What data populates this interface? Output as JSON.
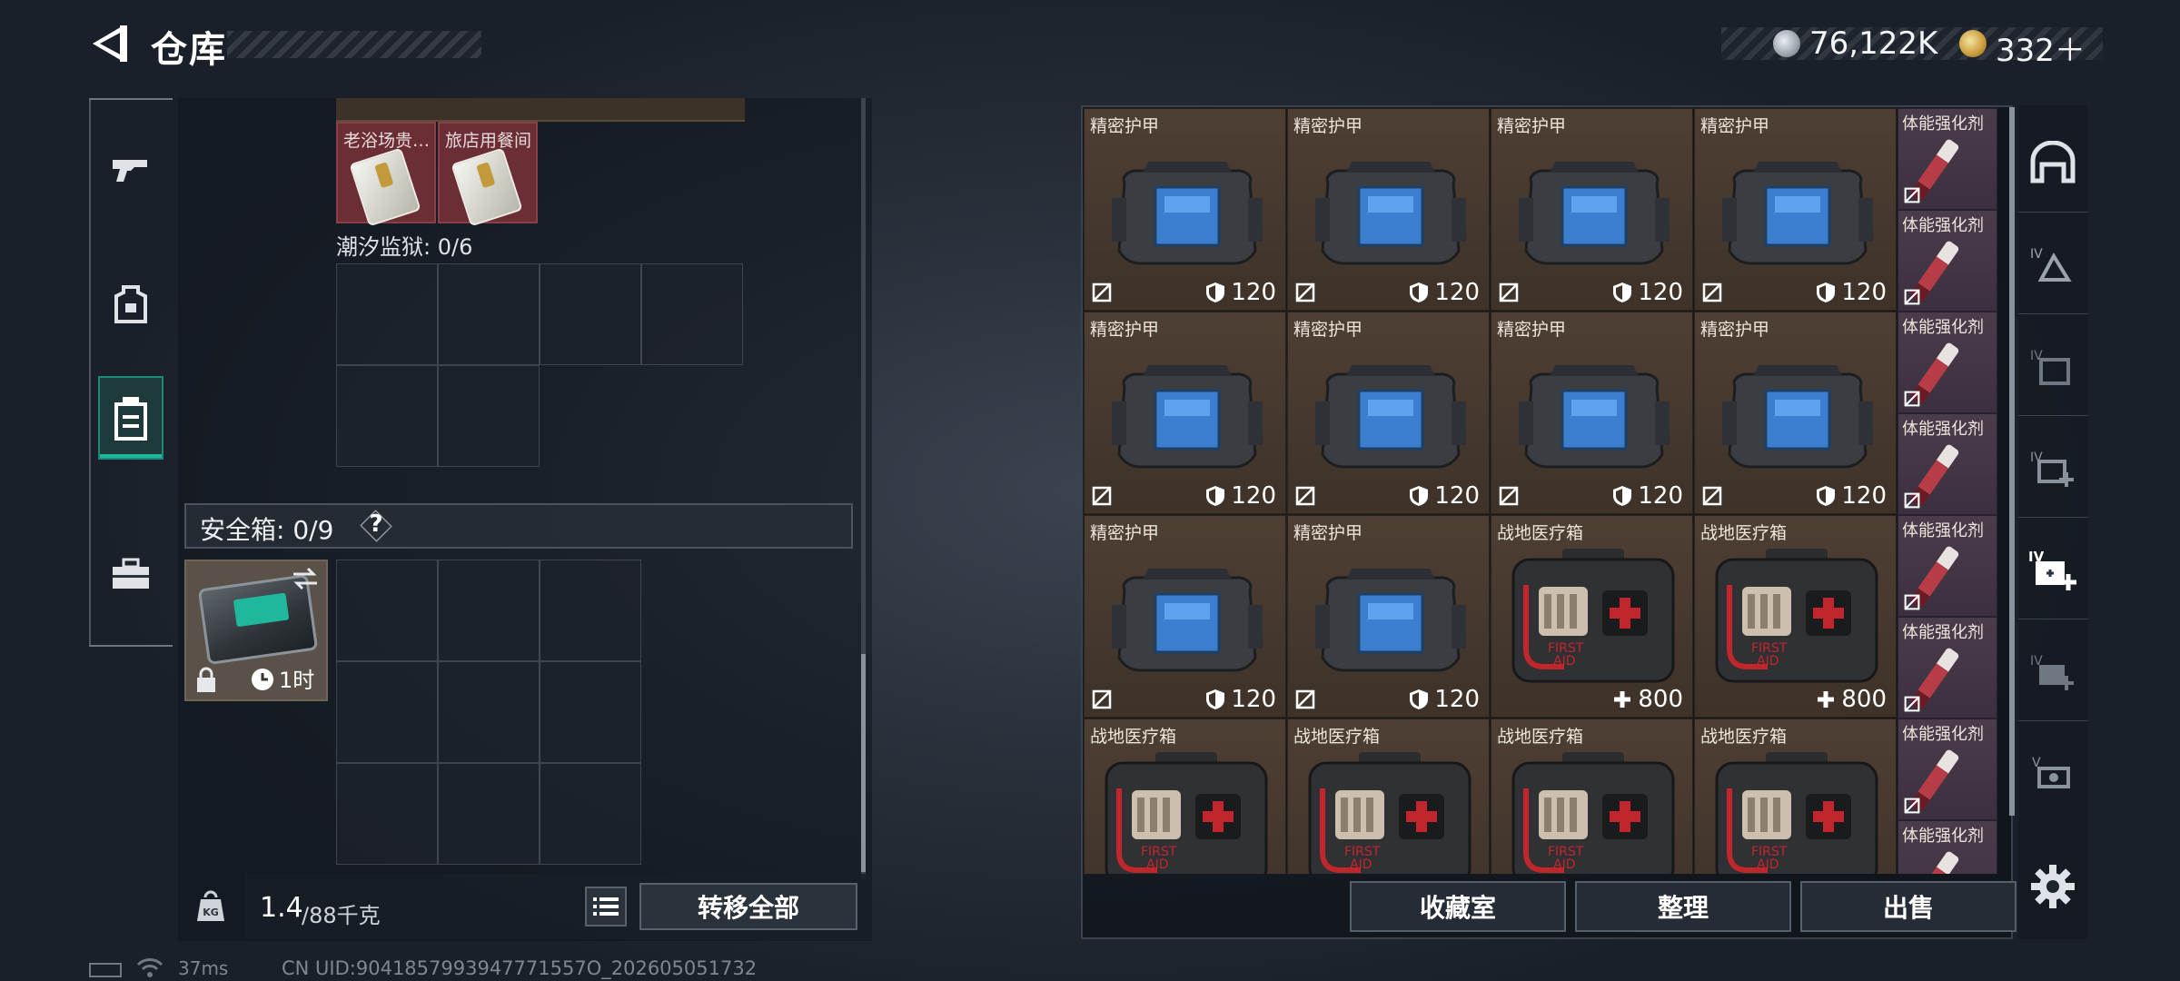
{
  "header": {
    "title": "仓库",
    "currency_silver": "76,122K",
    "currency_gold": "332＋"
  },
  "left_nav": {
    "items": [
      "weapon-icon",
      "armor-icon",
      "storage-icon",
      "case-icon"
    ],
    "selected": "storage"
  },
  "container": {
    "keys": [
      {
        "label": "老浴场贵…"
      },
      {
        "label": "旅店用餐间"
      }
    ],
    "prison_label": "潮汐监狱: 0/6",
    "safe_label": "安全箱: 0/9",
    "safe_help": "?",
    "safebox_time": "1时"
  },
  "footer_left": {
    "weight": "1.4",
    "weight_max": "/88千克",
    "transfer_all": "转移全部"
  },
  "grid": {
    "rows": [
      [
        {
          "name": "精密护甲",
          "type": "armor",
          "stat": "120"
        },
        {
          "name": "精密护甲",
          "type": "armor",
          "stat": "120"
        },
        {
          "name": "精密护甲",
          "type": "armor",
          "stat": "120"
        },
        {
          "name": "精密护甲",
          "type": "armor",
          "stat": "120"
        }
      ],
      [
        {
          "name": "精密护甲",
          "type": "armor",
          "stat": "120"
        },
        {
          "name": "精密护甲",
          "type": "armor",
          "stat": "120"
        },
        {
          "name": "精密护甲",
          "type": "armor",
          "stat": "120"
        },
        {
          "name": "精密护甲",
          "type": "armor",
          "stat": "120"
        }
      ],
      [
        {
          "name": "精密护甲",
          "type": "armor",
          "stat": "120"
        },
        {
          "name": "精密护甲",
          "type": "armor",
          "stat": "120"
        },
        {
          "name": "战地医疗箱",
          "type": "medkit",
          "stat": "800"
        },
        {
          "name": "战地医疗箱",
          "type": "medkit",
          "stat": "800"
        }
      ],
      [
        {
          "name": "战地医疗箱",
          "type": "medkit",
          "stat": ""
        },
        {
          "name": "战地医疗箱",
          "type": "medkit",
          "stat": ""
        },
        {
          "name": "战地医疗箱",
          "type": "medkit",
          "stat": ""
        },
        {
          "name": "战地医疗箱",
          "type": "medkit",
          "stat": ""
        }
      ]
    ],
    "side_items": [
      "体能强化剂",
      "体能强化剂",
      "体能强化剂",
      "体能强化剂",
      "体能强化剂",
      "体能强化剂",
      "体能强化剂",
      "体能强化剂"
    ]
  },
  "footer_right": {
    "collection": "收藏室",
    "sort": "整理",
    "sell": "出售"
  },
  "filters": [
    "helmet-icon",
    "helmet-tier-4-icon",
    "bag-tier-4-icon",
    "medkit-tier-4-icon",
    "medkit-tier-4-selected-icon",
    "medkit-tier-4-dim-icon",
    "chip-tier-5-icon"
  ],
  "status": {
    "ping": "37ms",
    "uid": "CN UID:9041857993947771557O_202605051732"
  },
  "colors": {
    "accent_teal": "#1fb89d",
    "armor_cell": "#4e3f33",
    "key_cell": "#6a2e34"
  }
}
